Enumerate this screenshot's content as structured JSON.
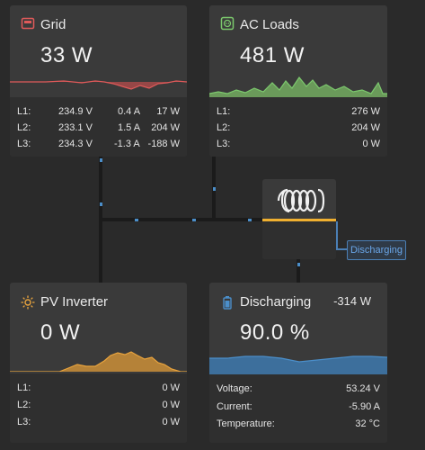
{
  "grid": {
    "title": "Grid",
    "power": "33 W",
    "rows": [
      {
        "label": "L1:",
        "voltage": "234.9 V",
        "current": "0.4 A",
        "power": "17 W"
      },
      {
        "label": "L2:",
        "voltage": "233.1 V",
        "current": "1.5 A",
        "power": "204 W"
      },
      {
        "label": "L3:",
        "voltage": "234.3 V",
        "current": "-1.3 A",
        "power": "-188 W"
      }
    ]
  },
  "ac_loads": {
    "title": "AC Loads",
    "power": "481 W",
    "rows": [
      {
        "label": "L1:",
        "power": "276 W"
      },
      {
        "label": "L2:",
        "power": "204 W"
      },
      {
        "label": "L3:",
        "power": "0 W"
      }
    ]
  },
  "pv_inverter": {
    "title": "PV Inverter",
    "power": "0 W",
    "rows": [
      {
        "label": "L1:",
        "power": "0 W"
      },
      {
        "label": "L2:",
        "power": "0 W"
      },
      {
        "label": "L3:",
        "power": "0 W"
      }
    ]
  },
  "battery": {
    "title": "Discharging",
    "power": "-314 W",
    "soc": "90.0 %",
    "rows": [
      {
        "label": "Voltage:",
        "value": "53.24 V"
      },
      {
        "label": "Current:",
        "value": "-5.90 A"
      },
      {
        "label": "Temperature:",
        "value": "32 °C"
      }
    ]
  },
  "inverter": {
    "status_badge": "Discharging"
  },
  "colors": {
    "grid_accent": "#e05a5a",
    "ac_accent": "#7cc96d",
    "pv_accent": "#e8a33d",
    "battery_accent": "#4b8ec9",
    "inverter_bar": "#f0b030"
  }
}
